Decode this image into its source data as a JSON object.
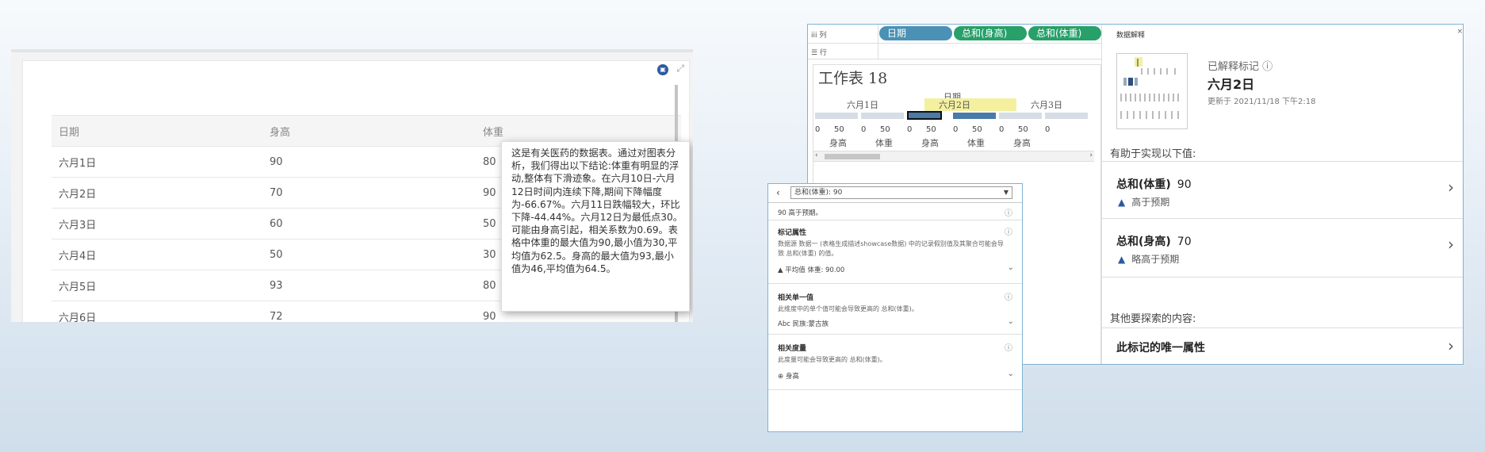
{
  "table": {
    "headers": [
      "日期",
      "身高",
      "体重"
    ],
    "rows": [
      [
        "六月1日",
        "90",
        "80"
      ],
      [
        "六月2日",
        "70",
        "90"
      ],
      [
        "六月3日",
        "60",
        "50"
      ],
      [
        "六月4日",
        "50",
        "30"
      ],
      [
        "六月5日",
        "93",
        "80"
      ],
      [
        "六月6日",
        "72",
        "90"
      ]
    ]
  },
  "tooltip_text": "这是有关医药的数据表。通过对图表分析，我们得出以下结论:体重有明显的浮动,整体有下滑迹象。在六月10日-六月12日时间内连续下降,期间下降幅度为-66.67%。六月11日跌幅较大，环比下降-44.44%。六月12日为最低点30。可能由身高引起，相关系数为0.69。表格中体重的最大值为90,最小值为30,平均值为62.5。身高的最大值为93,最小值为46,平均值为64.5。",
  "worksheet": {
    "col_shelf_label": "iii 列",
    "row_shelf_label": "☰ 行",
    "pills": [
      "日期",
      "总和(身高)",
      "总和(体重)"
    ],
    "title": "工作表  18",
    "axis_top_label": "日期",
    "days": [
      "六月1日",
      "六月2日",
      "六月3日"
    ],
    "axis_numbers": [
      "0",
      "50",
      "0",
      "50",
      "0",
      "50",
      "0",
      "50",
      "0",
      "50",
      "0"
    ],
    "axis_names": [
      "身高",
      "体重",
      "身高",
      "体重",
      "身高"
    ]
  },
  "explain": {
    "panel_title": "数据解释",
    "close": "×",
    "explained_label": "已解释标记 ⓘ",
    "mark_date": "六月2日",
    "updated": "更新于 2021/11/18 下午2:18",
    "helps": "有助于实现以下值:",
    "cards": [
      {
        "title": "总和(体重)",
        "value": "90",
        "sub": "高于预期"
      },
      {
        "title": "总和(身高)",
        "value": "70",
        "sub": "略高于预期"
      }
    ],
    "other": "其他要探索的内容:",
    "unique_title": "此标记的唯一属性"
  },
  "dropdown": {
    "select_value": "总和(体重): 90",
    "higher": "90 高于预期。",
    "sections": [
      {
        "title": "标记属性",
        "desc": "数据源 数据一 (表格生成描述showcase数据) 中的记录假别值及其聚合可能会导致 总和(体重) 的值。",
        "item": "▲ 平均值 体重: 90.00"
      },
      {
        "title": "相关单一值",
        "desc": "此维度中的单个值可能会导致更高的 总和(体重)。",
        "item": "Abc 民族:蒙古族"
      },
      {
        "title": "相关度量",
        "desc": "此度量可能会导致更高的 总和(体重)。",
        "item": "⊕ 身高"
      }
    ]
  },
  "colors": {
    "pill_dimension": "#4a91b5",
    "pill_measure": "#27a06a",
    "bar_blue": "#4a7aa8",
    "highlight_yellow": "#f4f0a0",
    "panel_border": "#7fb2d6"
  }
}
